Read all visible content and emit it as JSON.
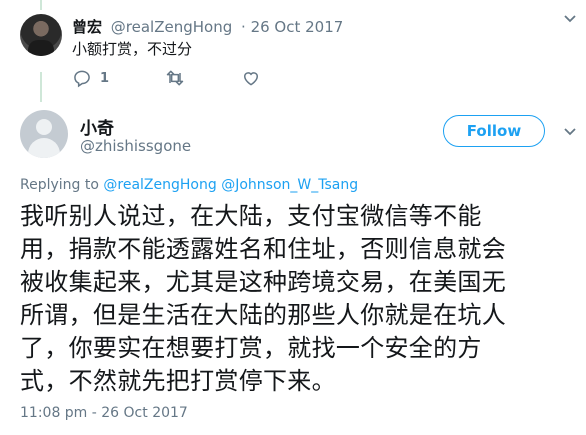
{
  "parent_tweet": {
    "name": "曾宏",
    "handle": "@realZengHong",
    "date": "· 26 Oct 2017",
    "text": "小额打赏，不过分",
    "reply_count": "1"
  },
  "main_tweet": {
    "name": "小奇",
    "handle": "@zhishissgone",
    "follow_label": "Follow",
    "replying_prefix": "Replying to",
    "replying_to": [
      "@realZengHong",
      "@Johnson_W_Tsang"
    ],
    "text_lines": [
      "我听别人说过，在大陆，支付宝微信等不能",
      "用，捐款不能透露姓名和住址，否则信息就会",
      "被收集起来，尤其是这种跨境交易，在美国无",
      "所谓，但是生活在大陆的那些人你就是在坑人",
      "了，你要实在想要打赏，就找一个安全的方",
      "式，不然就先把打赏停下来。"
    ],
    "timestamp": "11:08 pm - 26 Oct 2017"
  },
  "colors": {
    "accent": "#1da1f2",
    "muted": "#657786",
    "text": "#14171a",
    "thread_line": "#cfe7d8"
  }
}
